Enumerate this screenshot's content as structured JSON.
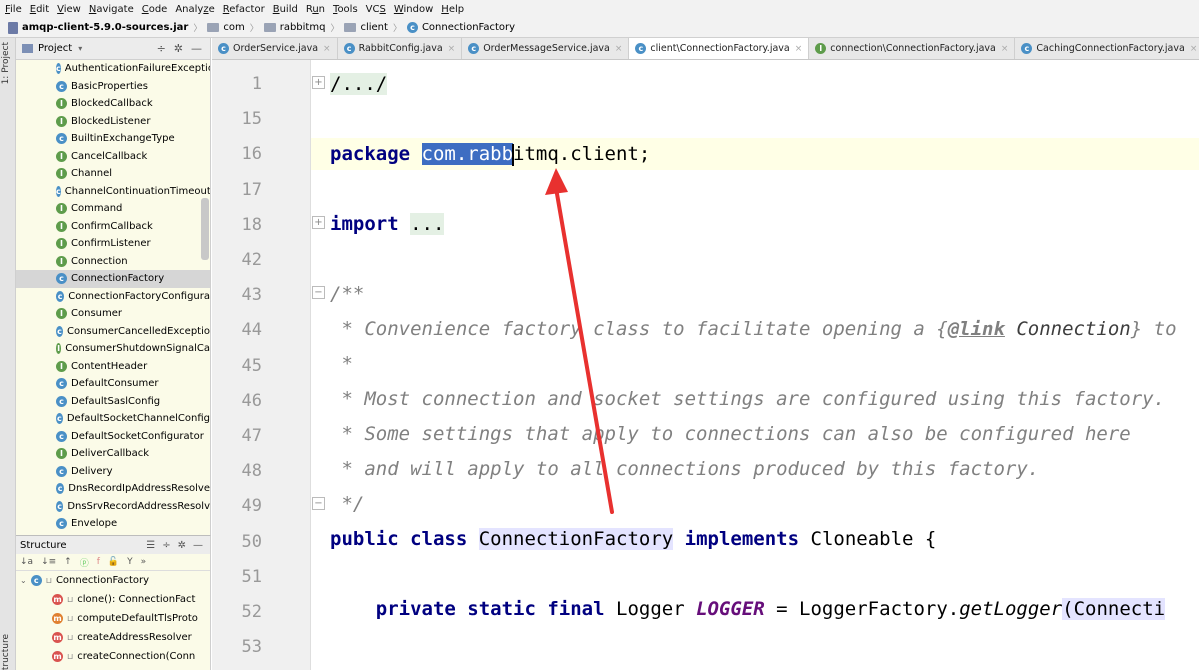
{
  "menu": [
    {
      "pre": "",
      "u": "F",
      "post": "ile"
    },
    {
      "pre": "",
      "u": "E",
      "post": "dit"
    },
    {
      "pre": "",
      "u": "V",
      "post": "iew"
    },
    {
      "pre": "",
      "u": "N",
      "post": "avigate"
    },
    {
      "pre": "",
      "u": "C",
      "post": "ode"
    },
    {
      "pre": "Analy",
      "u": "z",
      "post": "e"
    },
    {
      "pre": "",
      "u": "R",
      "post": "efactor"
    },
    {
      "pre": "",
      "u": "B",
      "post": "uild"
    },
    {
      "pre": "R",
      "u": "u",
      "post": "n"
    },
    {
      "pre": "",
      "u": "T",
      "post": "ools"
    },
    {
      "pre": "VC",
      "u": "S",
      "post": ""
    },
    {
      "pre": "",
      "u": "W",
      "post": "indow"
    },
    {
      "pre": "",
      "u": "H",
      "post": "elp"
    }
  ],
  "breadcrumb": {
    "jar": "amqp-client-5.9.0-sources.jar",
    "pkg1": "com",
    "pkg2": "rabbitmq",
    "pkg3": "client",
    "cls": "ConnectionFactory"
  },
  "toolstrip": {
    "project_tab": "1: Project",
    "structure_tab": "Structure"
  },
  "project": {
    "title": "Project",
    "items": [
      {
        "name": "AuthenticationFailureExceptio",
        "kind": "c"
      },
      {
        "name": "BasicProperties",
        "kind": "c"
      },
      {
        "name": "BlockedCallback",
        "kind": "i"
      },
      {
        "name": "BlockedListener",
        "kind": "i"
      },
      {
        "name": "BuiltinExchangeType",
        "kind": "c"
      },
      {
        "name": "CancelCallback",
        "kind": "i"
      },
      {
        "name": "Channel",
        "kind": "i"
      },
      {
        "name": "ChannelContinuationTimeout",
        "kind": "c"
      },
      {
        "name": "Command",
        "kind": "i"
      },
      {
        "name": "ConfirmCallback",
        "kind": "i"
      },
      {
        "name": "ConfirmListener",
        "kind": "i"
      },
      {
        "name": "Connection",
        "kind": "i"
      },
      {
        "name": "ConnectionFactory",
        "kind": "c",
        "selected": true
      },
      {
        "name": "ConnectionFactoryConfigura",
        "kind": "c"
      },
      {
        "name": "Consumer",
        "kind": "i"
      },
      {
        "name": "ConsumerCancelledExceptio",
        "kind": "c"
      },
      {
        "name": "ConsumerShutdownSignalCa",
        "kind": "i"
      },
      {
        "name": "ContentHeader",
        "kind": "i"
      },
      {
        "name": "DefaultConsumer",
        "kind": "c"
      },
      {
        "name": "DefaultSaslConfig",
        "kind": "c"
      },
      {
        "name": "DefaultSocketChannelConfig",
        "kind": "c"
      },
      {
        "name": "DefaultSocketConfigurator",
        "kind": "c"
      },
      {
        "name": "DeliverCallback",
        "kind": "i"
      },
      {
        "name": "Delivery",
        "kind": "c"
      },
      {
        "name": "DnsRecordIpAddressResolve",
        "kind": "c"
      },
      {
        "name": "DnsSrvRecordAddressResolv",
        "kind": "c"
      },
      {
        "name": "Envelope",
        "kind": "c"
      }
    ]
  },
  "structure": {
    "title": "Structure",
    "root": "ConnectionFactory",
    "items": [
      {
        "name": "clone(): ConnectionFact",
        "kind": "m"
      },
      {
        "name": "computeDefaultTlsProto",
        "kind": "mo"
      },
      {
        "name": "createAddressResolver",
        "kind": "m"
      },
      {
        "name": "createConnection(Conn",
        "kind": "m"
      }
    ]
  },
  "tabs": [
    {
      "label": "OrderService.java",
      "kind": "c"
    },
    {
      "label": "RabbitConfig.java",
      "kind": "c"
    },
    {
      "label": "OrderMessageService.java",
      "kind": "c"
    },
    {
      "label": "client\\ConnectionFactory.java",
      "kind": "c",
      "active": true
    },
    {
      "label": "connection\\ConnectionFactory.java",
      "kind": "i"
    },
    {
      "label": "CachingConnectionFactory.java",
      "kind": "c"
    }
  ],
  "editor": {
    "line_numbers": [
      "1",
      "15",
      "16",
      "17",
      "18",
      "42",
      "43",
      "44",
      "45",
      "46",
      "47",
      "48",
      "49",
      "50",
      "51",
      "52",
      "53"
    ],
    "line1": "/.../",
    "kw_package": "package",
    "pkg_selected": "com.rabb",
    "pkg_rest": "itmq.client;",
    "kw_import": "import",
    "import_folded": "...",
    "doc_open": "/**",
    "doc44_a": " * Convenience factory class to facilitate opening a ",
    "doc44_link_open": "{",
    "doc44_tag": "@link",
    "doc44_ref": " Connection",
    "doc44_link_close": "}",
    "doc44_b": " to",
    "doc45": " *",
    "doc46": " * Most connection and socket settings are configured using this factory.",
    "doc47": " * Some settings that apply to connections can also be configured here",
    "doc48": " * and will apply to all connections produced by this factory.",
    "doc49": " */",
    "kw_public_class": "public class",
    "class_name": "ConnectionFactory",
    "kw_implements": "implements",
    "iface": "Cloneable {",
    "kw_psf": "private static final",
    "logger_type": "Logger",
    "logger_field": "LOGGER",
    "assign": " = LoggerFactory.",
    "get_logger": "getLogger",
    "call_rest": "(Connecti"
  },
  "annotation": {
    "color": "#e8312f"
  }
}
